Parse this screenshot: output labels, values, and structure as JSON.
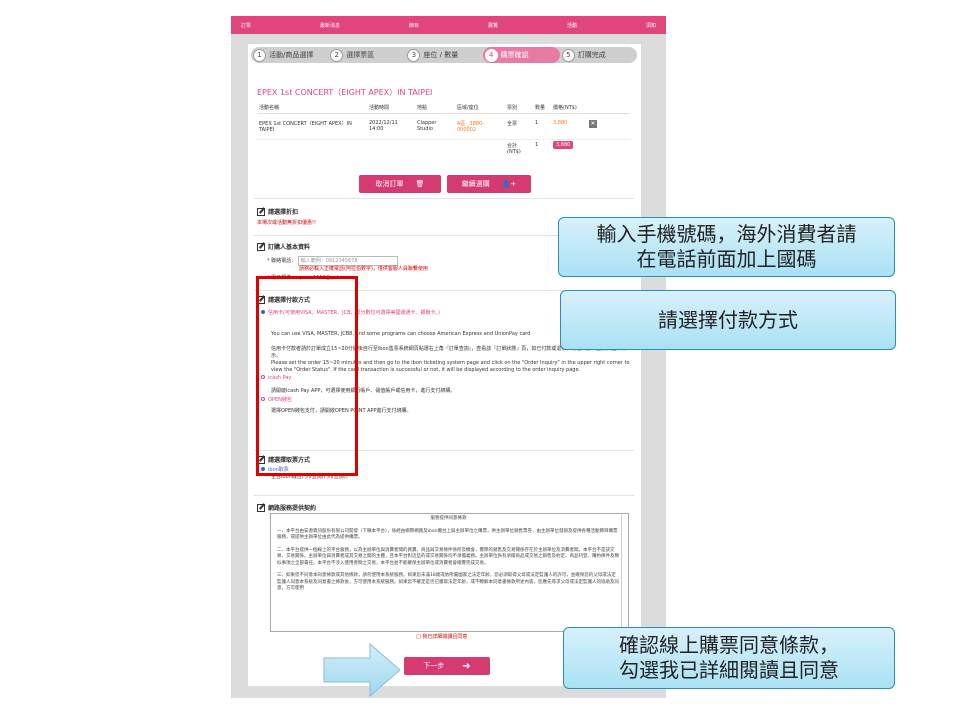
{
  "topnav": [
    "訂票",
    "最新消息",
    "節目",
    "展覽",
    "活動",
    "須知"
  ],
  "steps": [
    {
      "num": "1",
      "label": "活動/商品選擇"
    },
    {
      "num": "2",
      "label": "選擇票區"
    },
    {
      "num": "3",
      "label": "座位 / 數量"
    },
    {
      "num": "4",
      "label": "購票確認"
    },
    {
      "num": "5",
      "label": "訂購完成"
    }
  ],
  "concert_title": "EPEX 1st CONCERT（EIGHT APEX）IN TAIPEI",
  "order_table": {
    "headers": [
      "活動名稱",
      "活動時間",
      "地點",
      "區域/座位",
      "票別",
      "數量",
      "價格(NT$)"
    ],
    "row": {
      "name": "EPEX 1st CONCERT（EIGHT APEX）IN TAIPEI",
      "time": "2022/12/11 14:00",
      "venue": "Clapper Studio",
      "seat": "A區 _3880-000002",
      "ticket_type": "全票",
      "qty": "1",
      "price": "3,880"
    },
    "total_label": "合計 (NT$)",
    "total_qty": "1",
    "total_price": "3,880"
  },
  "buttons": {
    "cancel": "取消訂單",
    "continue": "繼續選購",
    "next": "下一步"
  },
  "discount": {
    "heading": "請選擇折扣",
    "note": "本場次或活動無折扣優惠!!"
  },
  "buyer": {
    "heading": "訂購人基本資料",
    "phone_label": "* 聯絡電話：",
    "phone_placeholder": "輸入範例：0912345678",
    "phone_hint": "請務必輸入正確電話(阿拉伯數字)，僅供客服人員聯繫使用",
    "email_label": "* 電子郵件：",
    "email_value": "qware1111@yahoo.com"
  },
  "payment": {
    "heading": "請選擇付款方式",
    "option1": "信用卡(可使用VISA、MASTER、JCB、部分數位可選擇美國運通卡、銀聯卡。)",
    "en_note": "You can use VISA, MASTER, JCB8, and some programs can choose American Express and UnionPay card",
    "zh_note": "信用卡付款者請於訂單成立15~20分鐘後自行至ibon售票系統網頁點選右上角『訂單查詢』，查看該『訂單狀態』頁，如已付款或退票，可在『訂單查詢頁面』顯示。",
    "en_note2": "Please set the order 15~20 minutes and then go to the ibon ticketing system page and click on the \"Order Inquiry\" in the upper right corner to view the \"Order Status\". If the card transaction is successful or not, it will be displayed according to the order inquiry page.",
    "option2": "icash Pay",
    "option2_note": "請開啟icash Pay APP，可選擇使用銀行帳戶、儲值帳戶或信用卡，進行支付綁購。",
    "option3": "OPEN錢包",
    "option3_note": "選擇OPEN錢包支付，請開啟OPEN POINT APP進行支付綁購。"
  },
  "pickup": {
    "heading": "請選擇取票方式",
    "option": "ibon取票",
    "note": "全台ibon機台門市查詢(門市查詢)。"
  },
  "terms": {
    "heading": "網路服務提供契約",
    "box_title": "服務提供同意條款",
    "p1": "一、本平台由安源資訊股份有限公司開發（下稱本平台），係經由網際網路及ibon機台上與主辦單位之購票，供主辦單位銷售票券，由主辦單位發辦及提供各種活動節目購票服務，或提供主辦單位由此代為提供購票。",
    "p2": "二、本平台提供一個線上的平台服務，以為主辦單位與消費者間的買賣。商品與交易條件係所及機會，實際的銷售及交易關係存在於主辦單位及消費者間。本平台不是該交易、交易關係。主辦單位與消費者成其交易之間的主體，且本平台對這些的或交易關係均不承擔義務。主辦單位負有承擔商品或交易之銷售及約定、商品刊登、購約條件及類似事項之全部責任。本平台不涉入使用者間之交易，本平台並不能確保主辦單位或消費者會確實完成交易。",
    "p3": "三、如果您不同意本同意條款或其他條款，請勿使用本系統服務。如果您未滿18歲或依所屬國家之法定年齡，您必須取得父母或法定監護人的許可，並確保您的父母或法定監護人同意本系統及同意書之條款後，方可使用本系統服務。如果您不確定是否已獲取法定年齡，或不瞭解本同意書條款所述內容，您應先尋求父母或法定監護人的協助及同意，方可使用",
    "agree": "□ 我已詳細閱讀且同意"
  },
  "callouts": {
    "phone": [
      "輸入手機號碼，海外消費者請",
      "在電話前面加上國碼"
    ],
    "payment": "請選擇付款方式",
    "agree": [
      "確認線上購票同意條款，",
      "勾選我已詳細閱讀且同意"
    ]
  }
}
